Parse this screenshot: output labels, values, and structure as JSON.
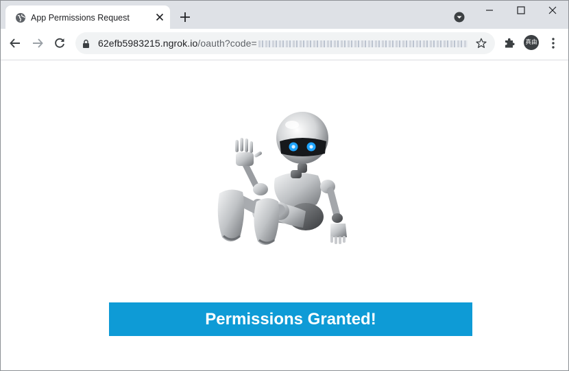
{
  "browser": {
    "tab": {
      "title": "App Permissions Request"
    },
    "address_bar": {
      "host": "62efb5983215.ngrok.io",
      "path": "/oauth?code="
    },
    "profile": {
      "avatar_text": "真由"
    }
  },
  "page": {
    "banner_text": "Permissions Granted!"
  },
  "icons": {
    "favicon": "globe-icon",
    "tab_close": "close-icon",
    "new_tab": "plus-icon",
    "tab_search": "tab-search-icon",
    "back": "arrow-left-icon",
    "forward": "arrow-right-icon",
    "reload": "reload-icon",
    "lock": "lock-icon",
    "bookmark": "star-icon",
    "extensions": "puzzle-icon",
    "menu": "kebab-menu-icon",
    "minimize": "minimize-icon",
    "maximize": "maximize-icon",
    "close_window": "close-icon"
  },
  "colors": {
    "tabstrip": "#dee1e6",
    "banner": "#0e9bd6",
    "banner_text": "#ffffff"
  }
}
